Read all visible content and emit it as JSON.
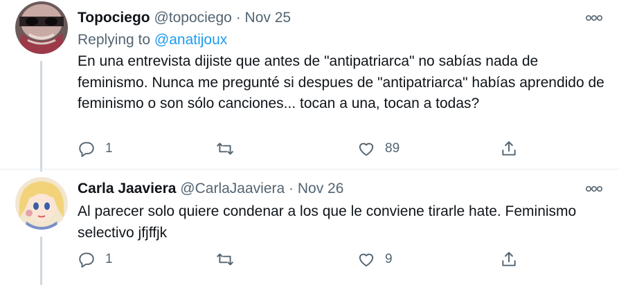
{
  "tweets": [
    {
      "display_name": "Topociego",
      "handle": "@topociego",
      "separator": "·",
      "date": "Nov 25",
      "replying_prefix": "Replying to",
      "replying_to": "@anatijoux",
      "text": "En una entrevista dijiste que antes de \"antipatriarca\" no sabías nada de feminismo. Nunca me pregunté si despues de \"antipatriarca\" habías aprendido de feminismo o son sólo canciones... tocan a una, tocan a todas?",
      "replies": "1",
      "retweets": "",
      "likes": "89",
      "icons": {
        "reply": "reply-icon",
        "retweet": "retweet-icon",
        "like": "heart-icon",
        "share": "share-icon",
        "more": "more-icon"
      }
    },
    {
      "display_name": "Carla Jaaviera",
      "handle": "@CarlaJaaviera",
      "separator": "·",
      "date": "Nov 26",
      "text": "Al parecer solo quiere condenar a los que le conviene tirarle hate. Feminismo selectivo jfjffjk",
      "replies": "1",
      "retweets": "",
      "likes": "9",
      "icons": {
        "reply": "reply-icon",
        "retweet": "retweet-icon",
        "like": "heart-icon",
        "share": "share-icon",
        "more": "more-icon"
      }
    }
  ],
  "colors": {
    "text": "#0f1419",
    "muted": "#536471",
    "link": "#1d9bf0",
    "thread_line": "#cfd9de"
  }
}
